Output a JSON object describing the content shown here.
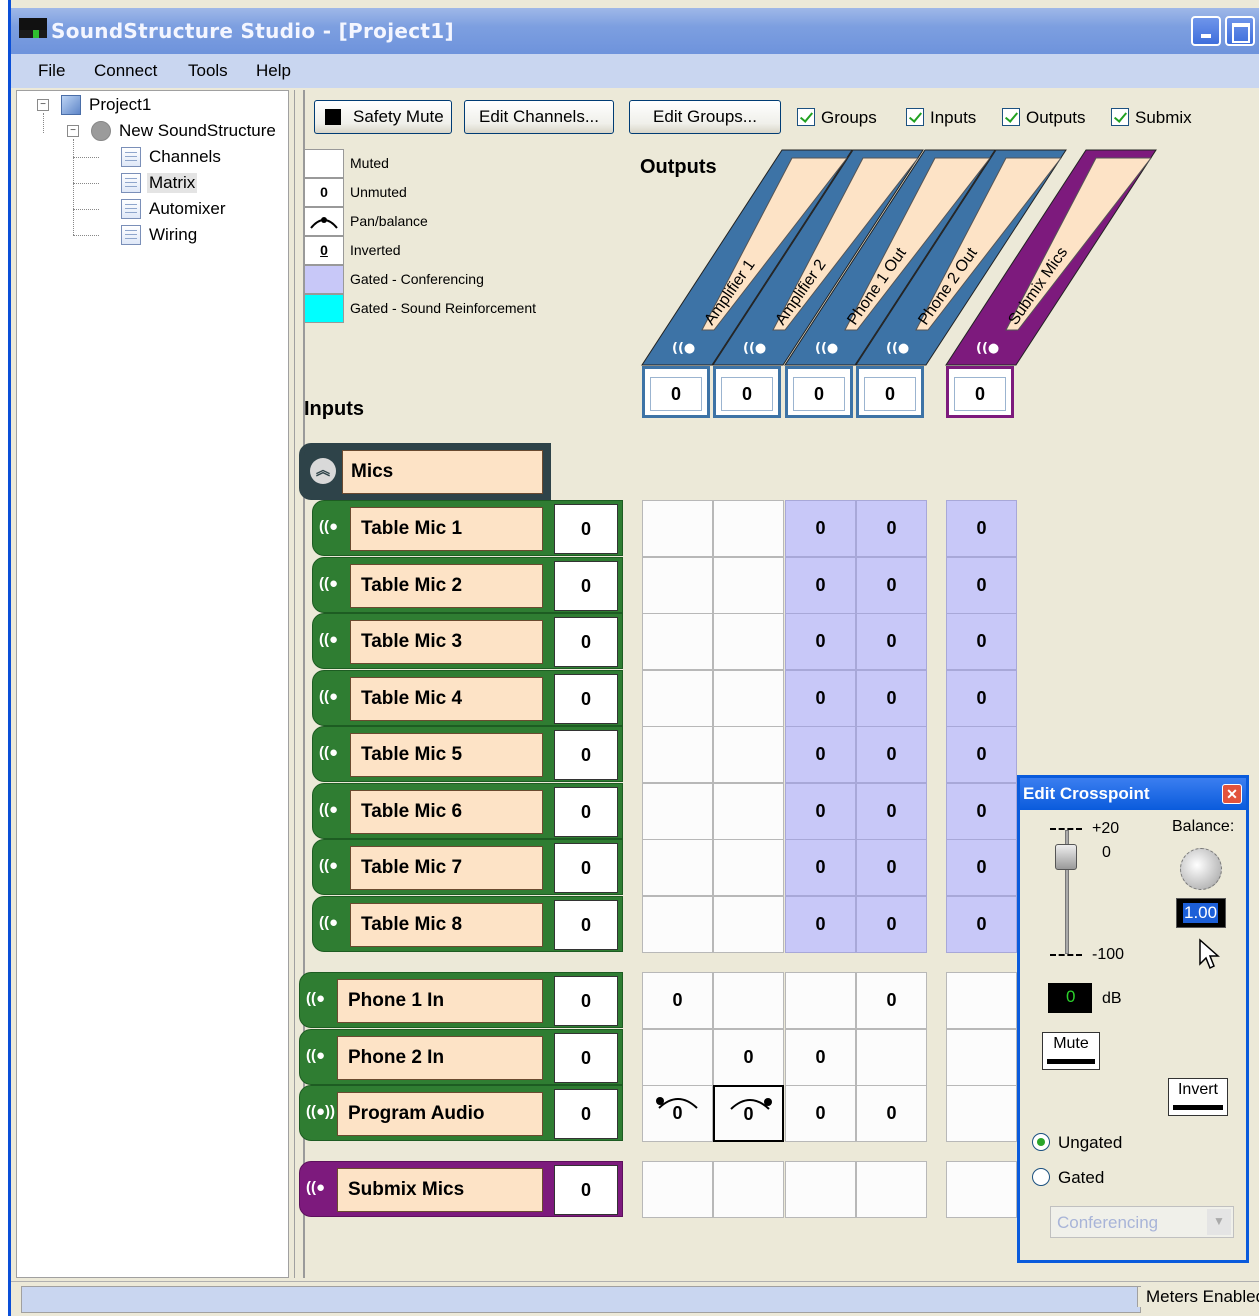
{
  "window": {
    "title": "SoundStructure Studio - [Project1]"
  },
  "menu": {
    "items": [
      "File",
      "Connect",
      "Tools",
      "Help"
    ]
  },
  "tree": {
    "project": "Project1",
    "device": "New SoundStructure",
    "children": [
      "Channels",
      "Matrix",
      "Automixer",
      "Wiring"
    ]
  },
  "toolbar": {
    "safety_mute": "Safety Mute",
    "edit_channels": "Edit Channels...",
    "edit_groups": "Edit Groups...",
    "checkboxes": [
      "Groups",
      "Inputs",
      "Outputs",
      "Submix"
    ]
  },
  "legend": [
    {
      "symbol": "",
      "label": "Muted",
      "color": "#ffffff"
    },
    {
      "symbol": "0",
      "label": "Unmuted",
      "color": "#ffffff"
    },
    {
      "symbol": "",
      "label": "Pan/balance",
      "color": "#ffffff"
    },
    {
      "symbol": "0",
      "label": "Inverted",
      "color": "#ffffff"
    },
    {
      "symbol": "",
      "label": "Gated - Conferencing",
      "color": "#c8c8f8"
    },
    {
      "symbol": "",
      "label": "Gated - Sound Reinforcement",
      "color": "#00ffff"
    }
  ],
  "outputs_title": "Outputs",
  "inputs_title": "Inputs",
  "outputs": [
    {
      "name": "Amplifier 1",
      "value": "0",
      "color": "#3d73a6"
    },
    {
      "name": "Amplifier 2",
      "value": "0",
      "color": "#3d73a6"
    },
    {
      "name": "Phone 1 Out",
      "value": "0",
      "color": "#3d73a6"
    },
    {
      "name": "Phone 2 Out",
      "value": "0",
      "color": "#3d73a6"
    },
    {
      "name": "Submix Mics",
      "value": "0",
      "color": "#7d1a7d"
    }
  ],
  "group": {
    "name": "Mics"
  },
  "inputs": [
    {
      "name": "Table Mic 1",
      "value": "0",
      "icon": "((●"
    },
    {
      "name": "Table Mic 2",
      "value": "0",
      "icon": "((●"
    },
    {
      "name": "Table Mic 3",
      "value": "0",
      "icon": "((●"
    },
    {
      "name": "Table Mic 4",
      "value": "0",
      "icon": "((●"
    },
    {
      "name": "Table Mic 5",
      "value": "0",
      "icon": "((●"
    },
    {
      "name": "Table Mic 6",
      "value": "0",
      "icon": "((●"
    },
    {
      "name": "Table Mic 7",
      "value": "0",
      "icon": "((●"
    },
    {
      "name": "Table Mic 8",
      "value": "0",
      "icon": "((●"
    },
    {
      "name": "Phone 1 In",
      "value": "0",
      "icon": "((●"
    },
    {
      "name": "Phone 2 In",
      "value": "0",
      "icon": "((●"
    },
    {
      "name": "Program Audio",
      "value": "0",
      "icon": "((●))"
    },
    {
      "name": "Submix Mics",
      "value": "0",
      "icon": "((●"
    }
  ],
  "matrix": [
    [
      [
        "",
        "m"
      ],
      [
        "",
        "m"
      ],
      [
        "0",
        "c"
      ],
      [
        "0",
        "c"
      ],
      [
        "0",
        "c"
      ]
    ],
    [
      [
        "",
        "m"
      ],
      [
        "",
        "m"
      ],
      [
        "0",
        "c"
      ],
      [
        "0",
        "c"
      ],
      [
        "0",
        "c"
      ]
    ],
    [
      [
        "",
        "m"
      ],
      [
        "",
        "m"
      ],
      [
        "0",
        "c"
      ],
      [
        "0",
        "c"
      ],
      [
        "0",
        "c"
      ]
    ],
    [
      [
        "",
        "m"
      ],
      [
        "",
        "m"
      ],
      [
        "0",
        "c"
      ],
      [
        "0",
        "c"
      ],
      [
        "0",
        "c"
      ]
    ],
    [
      [
        "",
        "m"
      ],
      [
        "",
        "m"
      ],
      [
        "0",
        "c"
      ],
      [
        "0",
        "c"
      ],
      [
        "0",
        "c"
      ]
    ],
    [
      [
        "",
        "m"
      ],
      [
        "",
        "m"
      ],
      [
        "0",
        "c"
      ],
      [
        "0",
        "c"
      ],
      [
        "0",
        "c"
      ]
    ],
    [
      [
        "",
        "m"
      ],
      [
        "",
        "m"
      ],
      [
        "0",
        "c"
      ],
      [
        "0",
        "c"
      ],
      [
        "0",
        "c"
      ]
    ],
    [
      [
        "",
        "m"
      ],
      [
        "",
        "m"
      ],
      [
        "0",
        "c"
      ],
      [
        "0",
        "c"
      ],
      [
        "0",
        "c"
      ]
    ],
    [
      [
        "0",
        "u"
      ],
      [
        "",
        "m"
      ],
      [
        "",
        "m"
      ],
      [
        "0",
        "u"
      ],
      [
        "",
        "m"
      ]
    ],
    [
      [
        "",
        "m"
      ],
      [
        "0",
        "u"
      ],
      [
        "0",
        "u"
      ],
      [
        "",
        "m"
      ],
      [
        "",
        "m"
      ]
    ],
    [
      [
        "0",
        "pl"
      ],
      [
        "0",
        "pr"
      ],
      [
        "0",
        "u"
      ],
      [
        "0",
        "u"
      ],
      [
        "",
        "m"
      ]
    ],
    [
      [
        "",
        "m"
      ],
      [
        "",
        "m"
      ],
      [
        "",
        "m"
      ],
      [
        "",
        "m"
      ],
      [
        "",
        "m"
      ]
    ]
  ],
  "dialog": {
    "title": "Edit Crosspoint",
    "plus20": "+20",
    "zero": "0",
    "minus100": "-100",
    "balance_label": "Balance:",
    "balance_value": "1.00",
    "gain_value": "0",
    "db": "dB",
    "mute": "Mute",
    "invert": "Invert",
    "ungated": "Ungated",
    "gated": "Gated",
    "gate_select": "Conferencing"
  },
  "status": {
    "meters": "Meters Enabled"
  }
}
